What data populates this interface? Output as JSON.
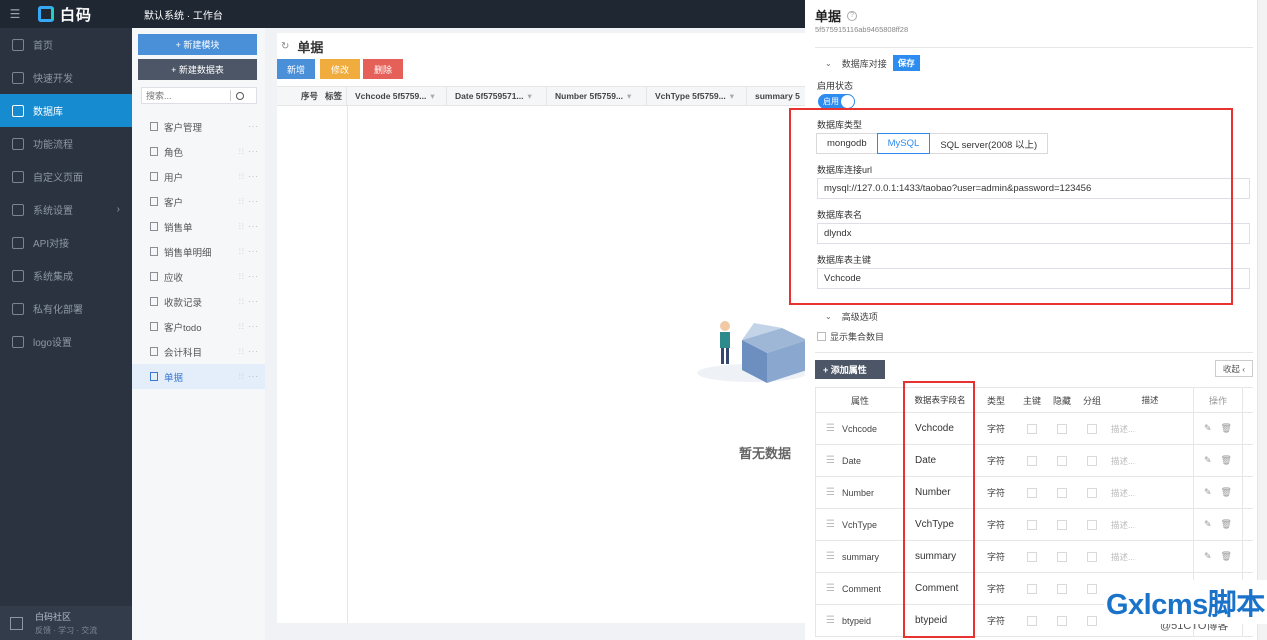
{
  "topbar": {
    "logo": "白码",
    "system_title": "默认系统 · 工作台"
  },
  "nav": {
    "items": [
      {
        "label": "首页"
      },
      {
        "label": "快速开发"
      },
      {
        "label": "数据库"
      },
      {
        "label": "功能流程"
      },
      {
        "label": "自定义页面"
      },
      {
        "label": "系统设置"
      },
      {
        "label": "API对接"
      },
      {
        "label": "系统集成"
      },
      {
        "label": "私有化部署"
      },
      {
        "label": "logo设置"
      }
    ],
    "footer_title": "白码社区",
    "footer_sub": "反馈 · 学习 · 交流"
  },
  "modules": {
    "new_module": "+ 新建模块",
    "new_table": "+ 新建数据表",
    "search_placeholder": "搜索...",
    "items": [
      "客户管理",
      "角色",
      "用户",
      "客户",
      "销售单",
      "销售单明细",
      "应收",
      "收款记录",
      "客户todo",
      "会计科目",
      "单据"
    ]
  },
  "main": {
    "title": "单据",
    "btn_add": "新增",
    "btn_edit": "修改",
    "btn_delete": "删除",
    "columns": [
      "序号",
      "标签",
      "Vchcode 5f5759...",
      "Date 5f5759571...",
      "Number 5f5759...",
      "VchType 5f5759...",
      "summary 5"
    ],
    "empty_text": "暂无数据"
  },
  "drawer": {
    "title": "单据",
    "id": "5f575915116ab9465808ff28",
    "db_section": "数据库对接",
    "save": "保存",
    "enable_label": "启用状态",
    "toggle_text": "启用",
    "db_type_label": "数据库类型",
    "db_types": [
      "mongodb",
      "MySQL",
      "SQL server(2008 以上)"
    ],
    "db_type_selected": "MySQL",
    "url_label": "数据库连接url",
    "url_value": "mysql://127.0.0.1:1433/taobao?user=admin&password=123456",
    "table_label": "数据库表名",
    "table_value": "dlyndx",
    "pk_label": "数据库表主键",
    "pk_value": "Vchcode",
    "advanced": "高级选项",
    "show_count": "显示集合数目",
    "add_attr": "+ 添加属性",
    "collapse": "收起 ‹",
    "table_headers": [
      "属性",
      "数据表字段名",
      "类型",
      "主键",
      "隐藏",
      "分组",
      "描述",
      "操作"
    ],
    "rows": [
      {
        "attr": "Vchcode",
        "field": "Vchcode",
        "type": "字符",
        "desc": "描述..."
      },
      {
        "attr": "Date",
        "field": "Date",
        "type": "字符",
        "desc": "描述..."
      },
      {
        "attr": "Number",
        "field": "Number",
        "type": "字符",
        "desc": "描述..."
      },
      {
        "attr": "VchType",
        "field": "VchType",
        "type": "字符",
        "desc": "描述..."
      },
      {
        "attr": "summary",
        "field": "summary",
        "type": "字符",
        "desc": "描述..."
      },
      {
        "attr": "Comment",
        "field": "Comment",
        "type": "字符",
        "desc": ""
      },
      {
        "attr": "btypeid",
        "field": "btypeid",
        "type": "字符",
        "desc": ""
      }
    ]
  },
  "watermark": {
    "text": "Gxlcms脚本",
    "under": "@51CTO博客"
  }
}
